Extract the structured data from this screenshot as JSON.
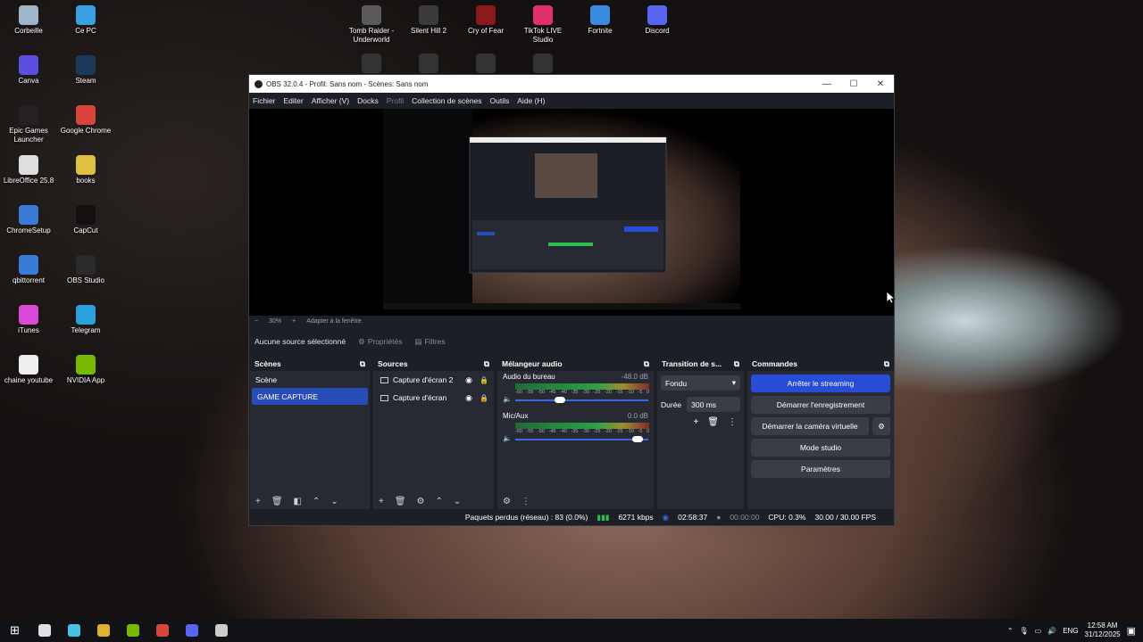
{
  "desktop_icons": [
    {
      "label": "Corbeille",
      "icon": "recycle-bin-icon",
      "color": "#9fb4c7"
    },
    {
      "label": "Ce PC",
      "icon": "pc-icon",
      "color": "#3aa0e6"
    },
    {
      "label": "Canva",
      "icon": "canva-icon",
      "color": "#5a4fe0"
    },
    {
      "label": "Steam",
      "icon": "steam-icon",
      "color": "#1b3a5a"
    },
    {
      "label": "Epic Games Launcher",
      "icon": "epic-icon",
      "color": "#222222"
    },
    {
      "label": "Google Chrome",
      "icon": "chrome-icon",
      "color": "#d9453a"
    },
    {
      "label": "LibreOffice 25.8",
      "icon": "libreoffice-icon",
      "color": "#dddddd"
    },
    {
      "label": "books",
      "icon": "folder-icon",
      "color": "#e0c040"
    },
    {
      "label": "ChromeSetup",
      "icon": "setup-icon",
      "color": "#3a7bd5"
    },
    {
      "label": "CapCut",
      "icon": "capcut-icon",
      "color": "#111111"
    },
    {
      "label": "qbittorrent",
      "icon": "qbittorrent-icon",
      "color": "#3a7bd5"
    },
    {
      "label": "OBS Studio",
      "icon": "obs-icon",
      "color": "#2a2a2a"
    },
    {
      "label": "iTunes",
      "icon": "itunes-icon",
      "color": "#d94ad9"
    },
    {
      "label": "Telegram",
      "icon": "telegram-icon",
      "color": "#2aa0e0"
    },
    {
      "label": "chaine youtube",
      "icon": "document-icon",
      "color": "#eeeeee"
    },
    {
      "label": "NVIDIA App",
      "icon": "nvidia-icon",
      "color": "#76b900"
    }
  ],
  "top_icons": [
    {
      "label": "Tomb Raider - Underworld",
      "color": "#5a5a5a"
    },
    {
      "label": "Silent Hill 2",
      "color": "#3a3a3a"
    },
    {
      "label": "Cry of Fear",
      "color": "#8a1a1a"
    },
    {
      "label": "TikTok LIVE Studio",
      "color": "#e0306a"
    },
    {
      "label": "Fortnite",
      "color": "#3a8ae0"
    },
    {
      "label": "Discord",
      "color": "#5865f2"
    }
  ],
  "obs": {
    "title": "OBS 32.0.4 - Profil: Sans nom - Scènes: Sans nom",
    "menu": [
      "Fichier",
      "Editer",
      "Afficher (V)",
      "Docks",
      "Profil",
      "Collection de scènes",
      "Outils",
      "Aide (H)"
    ],
    "preview_bar": {
      "zoom": "30%",
      "fit": "Adapter à la fenêtre"
    },
    "no_source": "Aucune source sélectionné",
    "properties_label": "Propriétés",
    "filters_label": "Filtres",
    "scenes": {
      "title": "Scènes",
      "items": [
        "Scène",
        "GAME CAPTURE"
      ],
      "selected": "GAME CAPTURE"
    },
    "sources": {
      "title": "Sources",
      "items": [
        "Capture d'écran 2",
        "Capture d'écran"
      ]
    },
    "mixer": {
      "title": "Mélangeur audio",
      "scale": [
        "-60",
        "-55",
        "-50",
        "-45",
        "-40",
        "-35",
        "-30",
        "-25",
        "-20",
        "-15",
        "-10",
        "-5",
        "0"
      ],
      "tracks": [
        {
          "name": "Audio du bureau",
          "db": "-48.0 dB",
          "volume": 0.32
        },
        {
          "name": "Mic/Aux",
          "db": "0.0 dB",
          "volume": 0.95
        }
      ]
    },
    "transitions": {
      "title": "Transition de s...",
      "type": "Fondu",
      "duration_label": "Durée",
      "duration": "300 ms"
    },
    "commands": {
      "title": "Commandes",
      "buttons": [
        "Arrêter le streaming",
        "Démarrer l'enregistrement",
        "Démarrer la caméra virtuelle",
        "Mode studio",
        "Paramètres"
      ]
    },
    "status": {
      "dropped": "Paquets perdus (réseau) : 83 (0.0%)",
      "bitrate": "6271 kbps",
      "stream_time": "02:58:37",
      "rec_time": "00:00:00",
      "cpu": "CPU: 0.3%",
      "fps": "30.00 / 30.00 FPS"
    }
  },
  "taskbar": {
    "lang": "ENG",
    "time": "12:58 AM",
    "date": "31/12/2025",
    "apps": [
      {
        "name": "task-view",
        "color": "#e0e0e0"
      },
      {
        "name": "copilot",
        "color": "#4ac0e0"
      },
      {
        "name": "explorer",
        "color": "#e0b030"
      },
      {
        "name": "nvidia",
        "color": "#76b900"
      },
      {
        "name": "chrome",
        "color": "#d9453a"
      },
      {
        "name": "discord",
        "color": "#5865f2"
      },
      {
        "name": "obs",
        "color": "#cccccc"
      }
    ]
  }
}
